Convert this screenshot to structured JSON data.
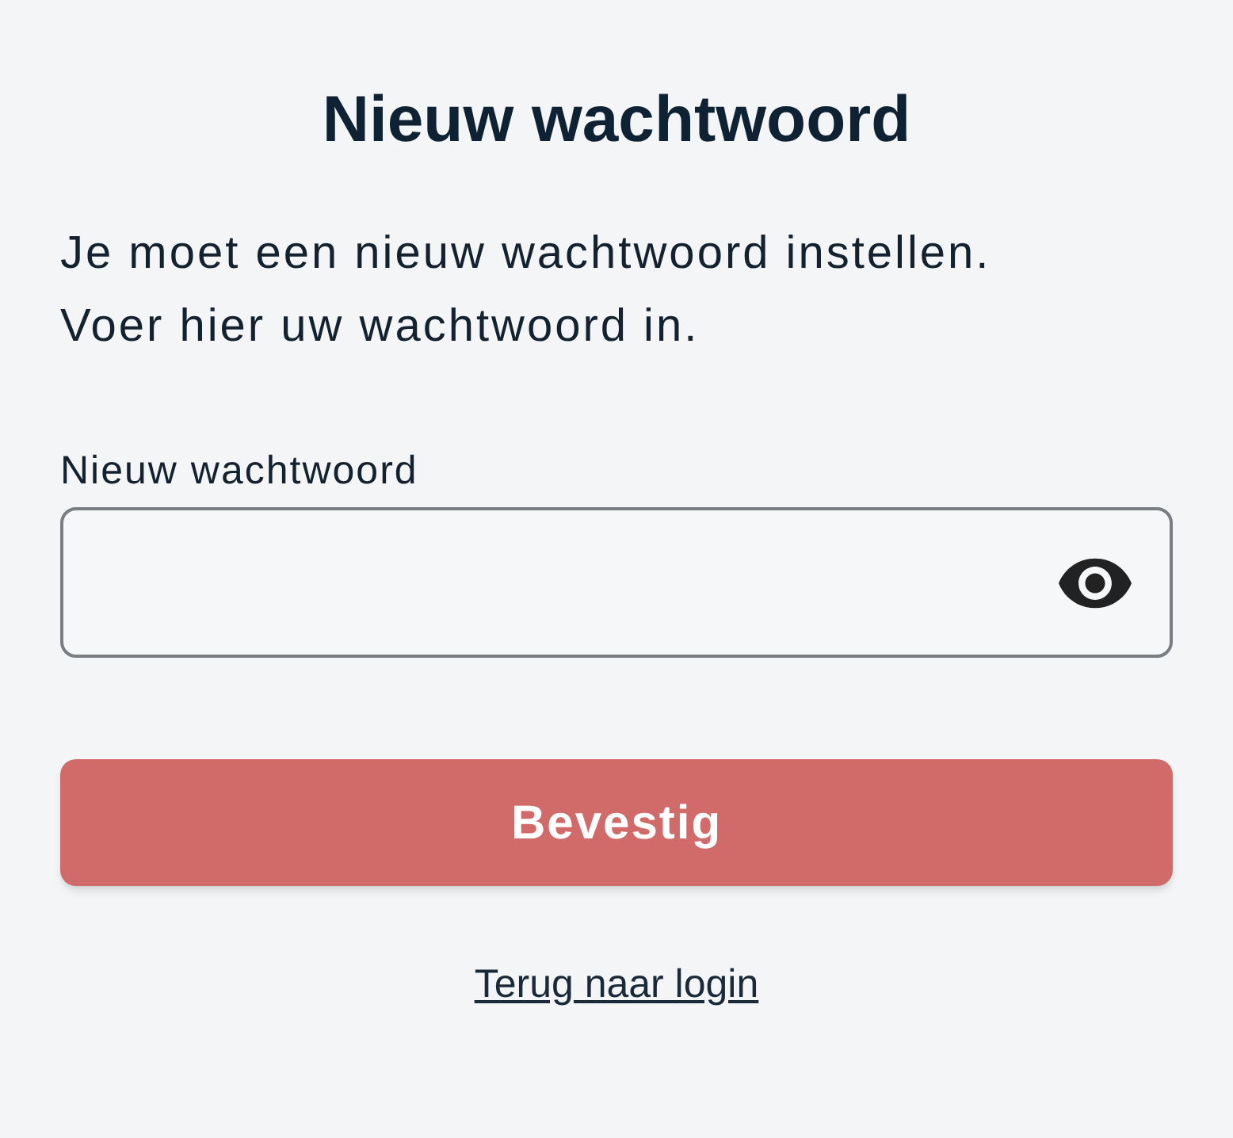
{
  "title": "Nieuw wachtwoord",
  "instructions": [
    "Je moet een nieuw wachtwoord instellen.",
    "Voer hier uw wachtwoord in."
  ],
  "password_field": {
    "label": "Nieuw wachtwoord"
  },
  "submit_button": {
    "label": "Bevestig",
    "disabled": true
  },
  "back_link": {
    "label": "Terug naar login"
  }
}
